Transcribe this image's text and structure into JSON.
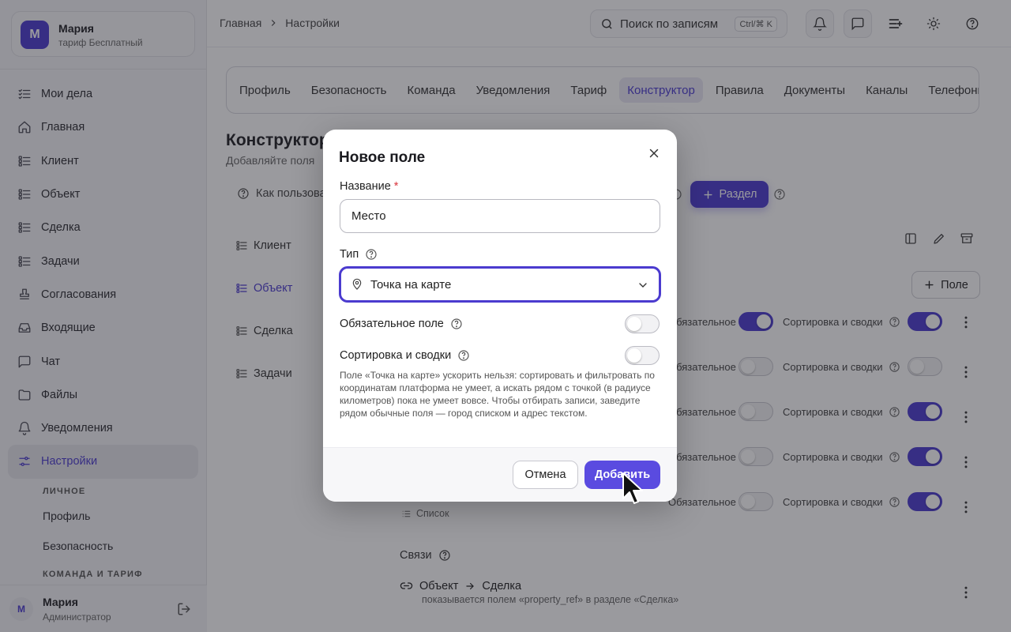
{
  "user": {
    "initial": "М",
    "name": "Мария",
    "plan": "тариф Бесплатный",
    "role": "Администратор"
  },
  "sidebar": {
    "items": [
      {
        "label": "Мои дела",
        "icon": "checklist-icon"
      },
      {
        "label": "Главная",
        "icon": "home-icon"
      },
      {
        "label": "Клиент",
        "icon": "list-icon"
      },
      {
        "label": "Объект",
        "icon": "list-icon"
      },
      {
        "label": "Сделка",
        "icon": "list-icon"
      },
      {
        "label": "Задачи",
        "icon": "list-icon"
      },
      {
        "label": "Согласования",
        "icon": "stamp-icon"
      },
      {
        "label": "Входящие",
        "icon": "inbox-icon"
      },
      {
        "label": "Чат",
        "icon": "chat-icon"
      },
      {
        "label": "Файлы",
        "icon": "folder-icon"
      },
      {
        "label": "Уведомления",
        "icon": "bell-icon"
      },
      {
        "label": "Настройки",
        "icon": "sliders-icon",
        "active": true
      }
    ],
    "sub_head_personal": "ЛИЧНОЕ",
    "sub_profile": "Профиль",
    "sub_security": "Безопасность",
    "sub_head_team": "КОМАНДА И ТАРИФ"
  },
  "breadcrumb": {
    "home": "Главная",
    "current": "Настройки"
  },
  "search": {
    "placeholder": "Поиск по записям",
    "shortcut": "Ctrl/⌘ K"
  },
  "tabs": [
    "Профиль",
    "Безопасность",
    "Команда",
    "Уведомления",
    "Тариф",
    "Конструктор",
    "Правила",
    "Документы",
    "Каналы",
    "Телефония"
  ],
  "active_tab": "Конструктор",
  "page": {
    "title": "Конструктор",
    "subtitle": "Добавляйте поля",
    "how_label": "Как пользоваться",
    "add_section": "Раздел",
    "add_field": "Поле"
  },
  "sections": [
    "Клиент",
    "Объект",
    "Сделка",
    "Задачи"
  ],
  "field_rows": {
    "required_label": "Обязательное",
    "sorting_label": "Сортировка и сводки",
    "rows": [
      {
        "required": true,
        "sorting": true
      },
      {
        "required": false,
        "sorting": false
      },
      {
        "required": false,
        "sorting": true
      },
      {
        "required": false,
        "sorting": true
      },
      {
        "required": false,
        "sorting": true
      }
    ]
  },
  "deal_type_field": {
    "type": "Список"
  },
  "links": {
    "title": "Связи",
    "from": "Объект",
    "to": "Сделка",
    "description": "показывается полем «property_ref» в разделе «Сделка»"
  },
  "modal": {
    "title": "Новое поле",
    "name_label": "Название",
    "required_mark": "*",
    "name_value": "Место",
    "type_label": "Тип",
    "type_value": "Точка на карте",
    "required_switch": "Обязательное поле",
    "sorting_switch": "Сортировка и сводки",
    "note": "Поле «Точка на карте» ускорить нельзя: сортировать и фильтровать по координатам платформа не умеет, а искать рядом с точкой (в радиусе километров) пока не умеет вовсе. Чтобы отбирать записи, заведите рядом обычные поля — город списком и адрес текстом.",
    "cancel": "Отмена",
    "add": "Добавить"
  },
  "colors": {
    "accent": "#4b3bcf",
    "danger": "#d9363e"
  }
}
